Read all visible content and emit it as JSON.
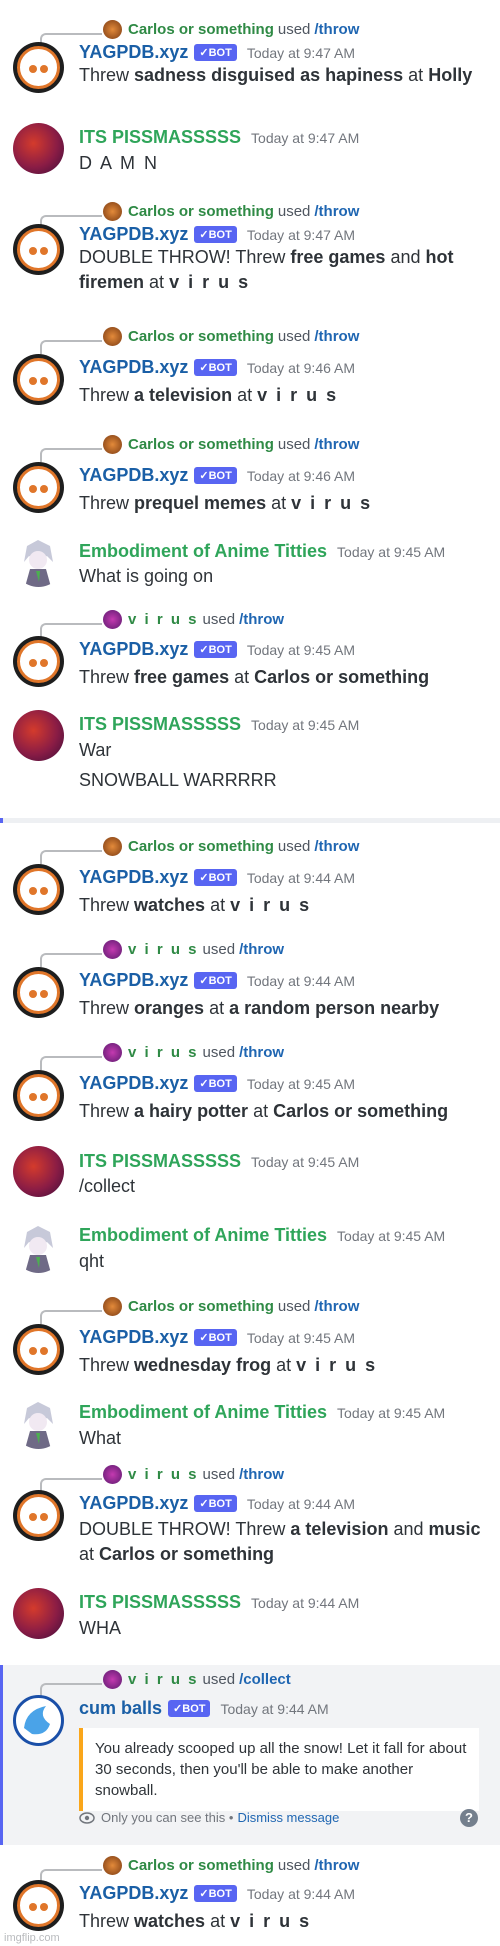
{
  "users": {
    "carlos": "Carlos or something",
    "virus": "v i r u s",
    "yag": "YAGPDB.xyz",
    "pis": "ITS PISSMASSSSS",
    "emb": "Embodiment of Anime Titties",
    "cum": "cum balls"
  },
  "common": {
    "used": "used",
    "bot": "✓BOT",
    "throw_cmd": "/throw",
    "collect_cmd": "/collect",
    "threw": "Threw",
    "at": "at",
    "and": "and",
    "double": "DOUBLE THROW! Threw"
  },
  "messages": {
    "m1": {
      "time": "Today at 9:47 AM",
      "item": "sadness disguised as hapiness",
      "target": "Holly"
    },
    "m2": {
      "time": "Today at 9:47 AM",
      "text": "D A M N"
    },
    "m3": {
      "time": "Today at 9:47 AM",
      "item1": "free games",
      "item2": "hot firemen",
      "target": "v i r u s"
    },
    "m4": {
      "time": "Today at 9:46 AM",
      "item": "a television",
      "target": "v i r u s"
    },
    "m5": {
      "time": "Today at 9:46 AM",
      "item": "prequel memes",
      "target": "v i r u s"
    },
    "m6": {
      "time": "Today at 9:45 AM",
      "text": "What is going on"
    },
    "m7": {
      "time": "Today at 9:45 AM",
      "item": "free games",
      "target": "Carlos or something"
    },
    "m8": {
      "time": "Today at 9:45 AM",
      "text1": "War",
      "text2": "SNOWBALL WARRRRR"
    },
    "m9": {
      "time": "Today at 9:44 AM",
      "item": "watches",
      "target": "v i r u s"
    },
    "m10": {
      "time": "Today at 9:44 AM",
      "item": "oranges",
      "target": "a random person nearby"
    },
    "m11": {
      "time": "Today at 9:45 AM",
      "item": "a hairy potter",
      "target": "Carlos or something"
    },
    "m12": {
      "time": "Today at 9:45 AM",
      "text": "/collect"
    },
    "m13": {
      "time": "Today at 9:45 AM",
      "text": "qht"
    },
    "m14": {
      "time": "Today at 9:45 AM",
      "item": "wednesday frog",
      "target": "v i r u s"
    },
    "m15": {
      "time": "Today at 9:45 AM",
      "text": "What"
    },
    "m16": {
      "time": "Today at 9:44 AM",
      "item1": "a television",
      "item2": "music",
      "target": "Carlos or something"
    },
    "m17": {
      "time": "Today at 9:44 AM",
      "text": "WHA"
    },
    "m18": {
      "time": "Today at 9:44 AM",
      "text": "You already scooped up all the snow! Let it fall for about 30 seconds, then you'll be able to make another snowball.",
      "only_you": "Only you can see this •",
      "dismiss": "Dismiss message",
      "help": "?"
    },
    "m19": {
      "time": "Today at 9:44 AM",
      "item": "watches",
      "target": "v i r u s"
    }
  },
  "watermark": "imgflip.com",
  "colors": {
    "bot_badge": "#5865f2",
    "reply_name": "#2f8a45",
    "command": "#1f66b2",
    "ephemeral_bar": "#faa61a"
  }
}
